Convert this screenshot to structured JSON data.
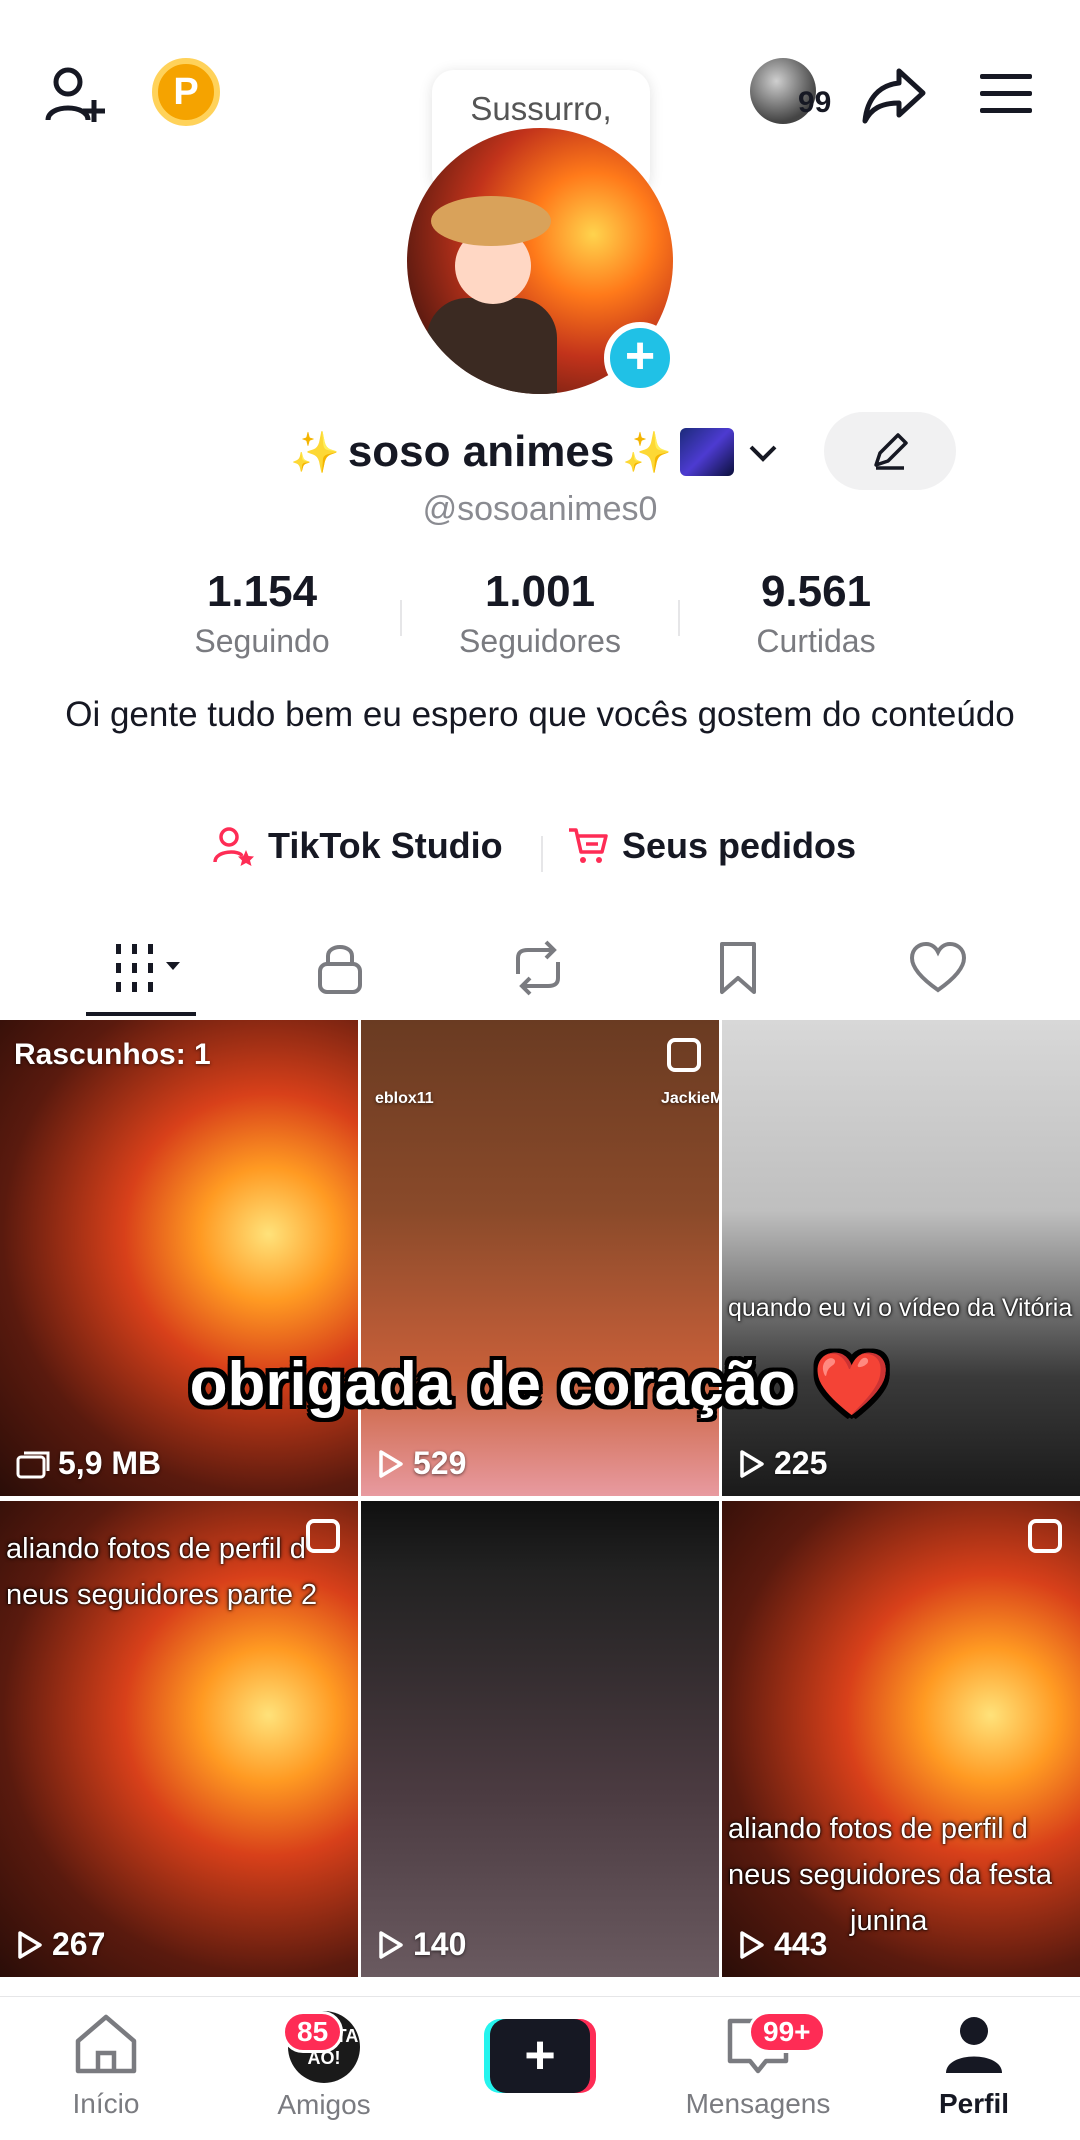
{
  "status_bar": {},
  "top_bar": {
    "coin_letter": "P",
    "mini_avatar_count": "99",
    "speech_bubble": "Sussurro, sussurro"
  },
  "profile": {
    "display_name_left_emoji": "✨",
    "display_name": "soso animes",
    "display_name_right_emoji": "✨",
    "handle": "@sosoanimes0",
    "bio": "Oi gente tudo bem eu espero que vocês gostem do conteúdo"
  },
  "stats": [
    {
      "value": "1.154",
      "label": "Seguindo"
    },
    {
      "value": "1.001",
      "label": "Seguidores"
    },
    {
      "value": "9.561",
      "label": "Curtidas"
    }
  ],
  "links": {
    "studio": "TikTok Studio",
    "orders": "Seus pedidos"
  },
  "grid": {
    "overlay_text": "obrigada de coração ❤️",
    "items": [
      {
        "top_label": "Rascunhos: 1",
        "meta": "5,9 MB"
      },
      {
        "views": "529",
        "watermark_left": "eblox11",
        "watermark_right": "JackieMi"
      },
      {
        "views": "225",
        "caption": "quando eu vi o vídeo da Vitória"
      },
      {
        "views": "267",
        "caption_line1": "aliando fotos de perfil d",
        "caption_line2": "neus seguidores parte 2"
      },
      {
        "views": "140"
      },
      {
        "views": "443",
        "caption_line1": "aliando fotos de perfil d",
        "caption_line2": "neus seguidores da festa",
        "caption_line3": "junina"
      }
    ]
  },
  "bottom_nav": {
    "home": "Início",
    "friends": "Amigos",
    "friends_badge": "85",
    "messages": "Mensagens",
    "messages_badge": "99+",
    "profile": "Perfil",
    "friends_avatar_text": "olive TA AÓ!"
  },
  "colors": {
    "accent": "#fe2c55",
    "cyan": "#25f4ee",
    "plus_badge": "#20c1e6",
    "coin": "#f5a300"
  }
}
